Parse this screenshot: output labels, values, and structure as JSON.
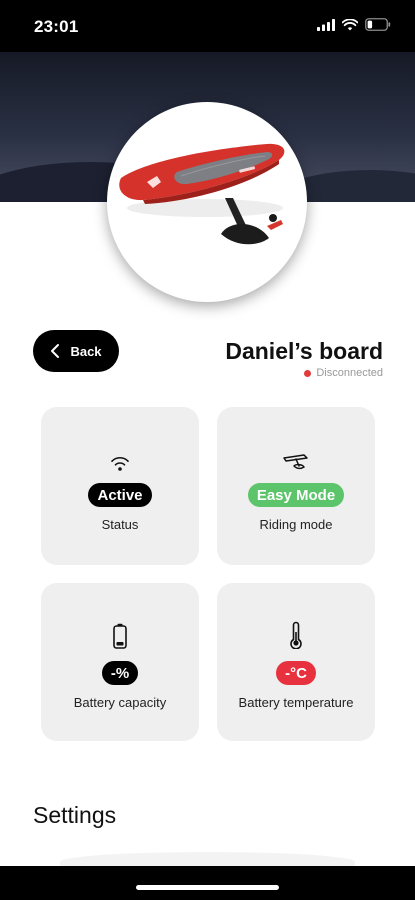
{
  "status_bar": {
    "time": "23:01"
  },
  "board": {
    "name": "Daniel’s board",
    "connection_status": "Disconnected",
    "connection_color": "#e23b3b",
    "image_icon": "efoil-board-image"
  },
  "nav": {
    "back_label": "Back"
  },
  "cards": {
    "status": {
      "icon": "wifi-icon",
      "value": "Active",
      "label": "Status",
      "badge_color": "#000000"
    },
    "riding_mode": {
      "icon": "foil-icon",
      "value": "Easy Mode",
      "label": "Riding mode",
      "badge_color": "#5cc46a"
    },
    "battery_capacity": {
      "icon": "battery-icon",
      "value": "-%",
      "label": "Battery capacity",
      "badge_color": "#000000"
    },
    "battery_temperature": {
      "icon": "thermometer-icon",
      "value": "-°C",
      "label": "Battery temperature",
      "badge_color": "#e8313f"
    }
  },
  "settings": {
    "title": "Settings"
  }
}
